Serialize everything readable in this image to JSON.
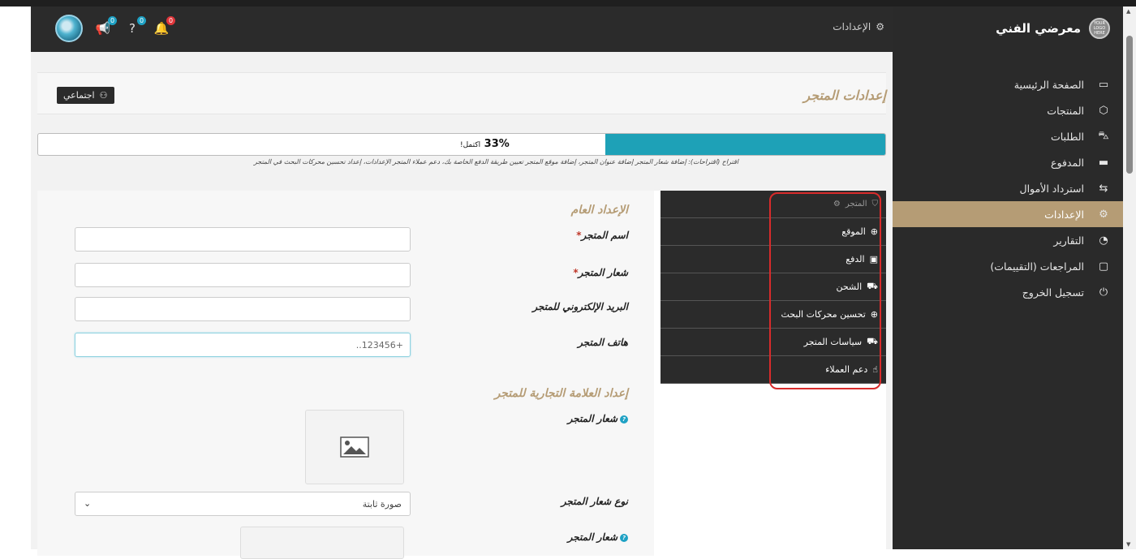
{
  "brand": {
    "name": "معرضي الفني",
    "logo_text": "YOUR LOGO HERE"
  },
  "sidebar": {
    "items": [
      {
        "label": "الصفحة الرئيسية",
        "icon": "home-icon",
        "glyph": "▭"
      },
      {
        "label": "المنتجات",
        "icon": "box-icon",
        "glyph": "⬡"
      },
      {
        "label": "الطلبات",
        "icon": "cart-icon",
        "glyph": "🛒"
      },
      {
        "label": "المدفوع",
        "icon": "card-icon",
        "glyph": "▬"
      },
      {
        "label": "استرداد الأموال",
        "icon": "refund-icon",
        "glyph": "⇆"
      },
      {
        "label": "الإعدادات",
        "icon": "settings-icon",
        "glyph": "⚙",
        "active": true
      },
      {
        "label": "التقارير",
        "icon": "chart-icon",
        "glyph": "◔"
      },
      {
        "label": "المراجعات (التقييمات)",
        "icon": "comment-icon",
        "glyph": "▢"
      },
      {
        "label": "تسجيل الخروج",
        "icon": "power-icon",
        "glyph": "⏻"
      }
    ]
  },
  "topbar": {
    "title": "الإعدادات",
    "badges": {
      "announce": "0",
      "help": "0",
      "notify": "0"
    }
  },
  "header": {
    "title": "إعدادات المتجر",
    "social_button": "اجتماعي"
  },
  "progress": {
    "percent": 33,
    "label": "33%",
    "suffix": "اكتمل!"
  },
  "suggestion": {
    "main": "اقتراح (اقتراحات): إضافة شعار المتجر إضافة عنوان المتجر، إضافة موقع المتجر تعيين طريقة الدفع الخاصة بك، دعم عملاء المتجر الإعدادات، إعداد تحسين محركات البحث في المتجر"
  },
  "tabs": [
    {
      "label": "المتجر",
      "icon": "store-icon",
      "glyph": "⛉"
    },
    {
      "label": "الموقع",
      "icon": "globe-icon",
      "glyph": "⊕"
    },
    {
      "label": "الدفع",
      "icon": "money-icon",
      "glyph": "▣"
    },
    {
      "label": "الشحن",
      "icon": "truck-icon",
      "glyph": "⛟"
    },
    {
      "label": "تحسين محركات البحث",
      "icon": "seo-icon",
      "glyph": "⊕"
    },
    {
      "label": "سياسات المتجر",
      "icon": "policy-icon",
      "glyph": "⛟"
    },
    {
      "label": "دعم العملاء",
      "icon": "thumbs-up-icon",
      "glyph": "👍"
    }
  ],
  "form": {
    "general_title": "الإعداد العام",
    "store_name_label": "اسم المتجر",
    "store_slogan_label": "شعار المتجر",
    "store_email_label": "البريد الإلكتروني للمتجر",
    "store_phone_label": "هاتف المتجر",
    "store_phone_value": "+123456..",
    "brand_title": "إعداد العلامة التجارية للمتجر",
    "store_logo_label": "شعار المتجر",
    "logo_type_label": "نوع شعار المتجر",
    "logo_type_value": "صورة ثابتة",
    "store_logo_label2": "شعار المتجر"
  }
}
